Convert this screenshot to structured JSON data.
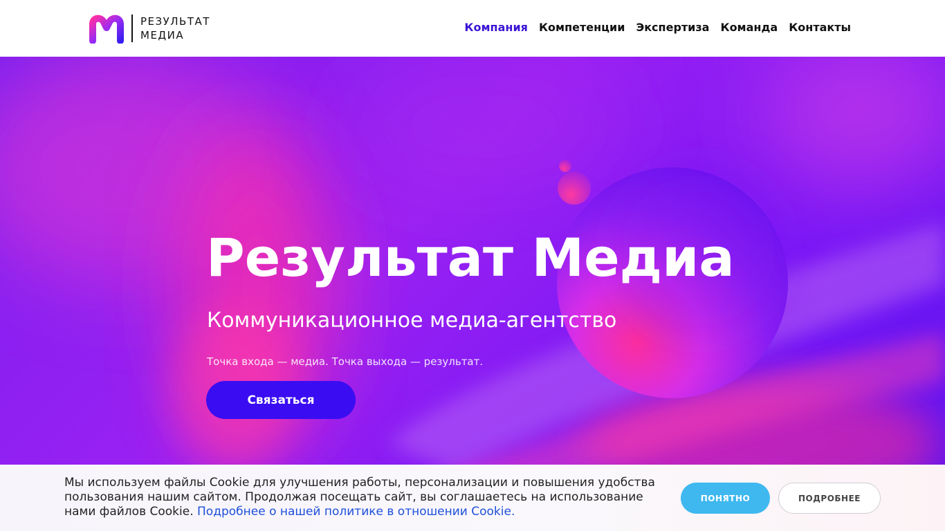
{
  "header": {
    "logo": {
      "line1": "РЕЗУЛЬТАТ",
      "line2": "МЕДИА"
    },
    "nav": [
      {
        "label": "Компания",
        "active": true
      },
      {
        "label": "Компетенции",
        "active": false
      },
      {
        "label": "Экспертиза",
        "active": false
      },
      {
        "label": "Команда",
        "active": false
      },
      {
        "label": "Контакты",
        "active": false
      }
    ]
  },
  "hero": {
    "title": "Результат Медиа",
    "subtitle": "Коммуникационное медиа-агентство",
    "tagline": "Точка входа — медиа. Точка выхода — результат.",
    "cta_label": "Связаться"
  },
  "cookie": {
    "text": "Мы используем файлы Cookie для улучшения работы, персонализации и повышения удобства пользования нашим сайтом. Продолжая посещать сайт, вы соглашаетесь на использование нами файлов Cookie. ",
    "link_text": "Подробнее о нашей политике в отношении Cookie.",
    "accept_label": "ПОНЯТНО",
    "more_label": "ПОДРОБНЕЕ"
  },
  "colors": {
    "accent": "#3a14d6",
    "cta": "#3a0cf2",
    "cookie_accept": "#3fb8ef",
    "cookie_link": "#1d4fd8"
  }
}
